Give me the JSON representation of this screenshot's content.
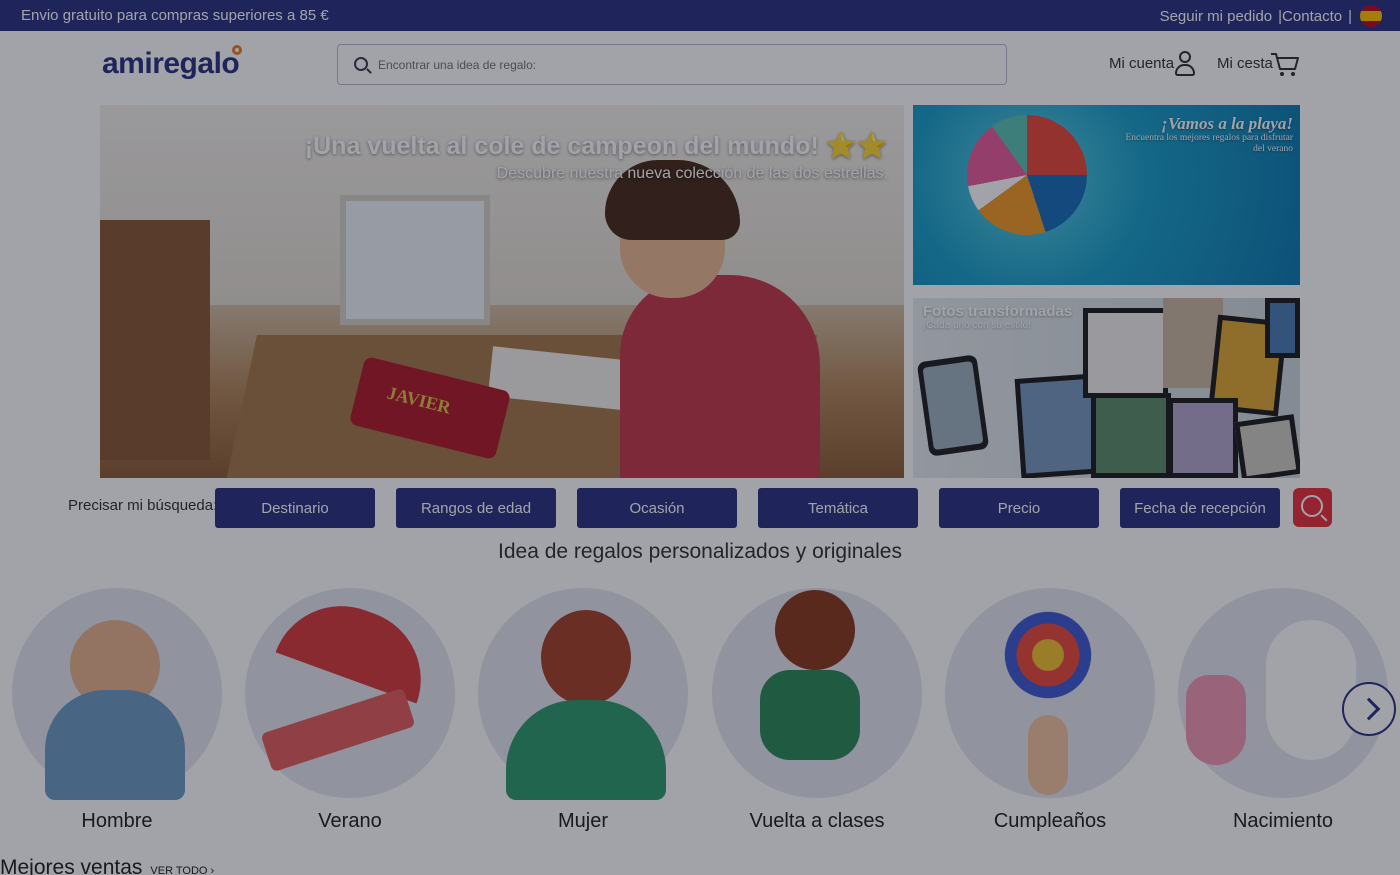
{
  "topbar": {
    "promo": "Envio gratuito para compras superiores a 85 €",
    "track": "Seguir mi pedido",
    "contact": "|Contacto",
    "separator": "|"
  },
  "header": {
    "logo": "amiregalo",
    "search_placeholder": "Encontrar una idea de regalo:",
    "account_label": "Mi cuenta",
    "cart_label": "Mi cesta"
  },
  "hero": {
    "title": "¡Una vuelta al cole de campeon del mundo! ⭐⭐",
    "subtitle": "Descubre nuestra nueva colección de las dos estrellas.",
    "pencilcase_text": "JAVIER"
  },
  "side_beach": {
    "title": "¡Vamos a la playa!",
    "subtitle": "Encuentra los mejores regalos para disfrutar del verano"
  },
  "side_photos": {
    "title": "Fotos transformadas",
    "subtitle": "¡Cada uno con su estilo!"
  },
  "filters": {
    "label": "Precisar mi búsqueda:",
    "buttons": [
      "Destinario",
      "Rangos de edad",
      "Ocasión",
      "Temática",
      "Precio",
      "Fecha de recepción"
    ]
  },
  "section_title": "Idea de regalos personalizados y originales",
  "categories": [
    "Hombre",
    "Verano",
    "Mujer",
    "Vuelta a clases",
    "Cumpleaños",
    "Nacimiento"
  ],
  "best_sellers": {
    "title": "Mejores ventas",
    "see_all": "VER TODO ›"
  },
  "colors": {
    "brand_navy": "#2c3580",
    "accent_red": "#e8343c",
    "logo_orange": "#f07e26"
  }
}
